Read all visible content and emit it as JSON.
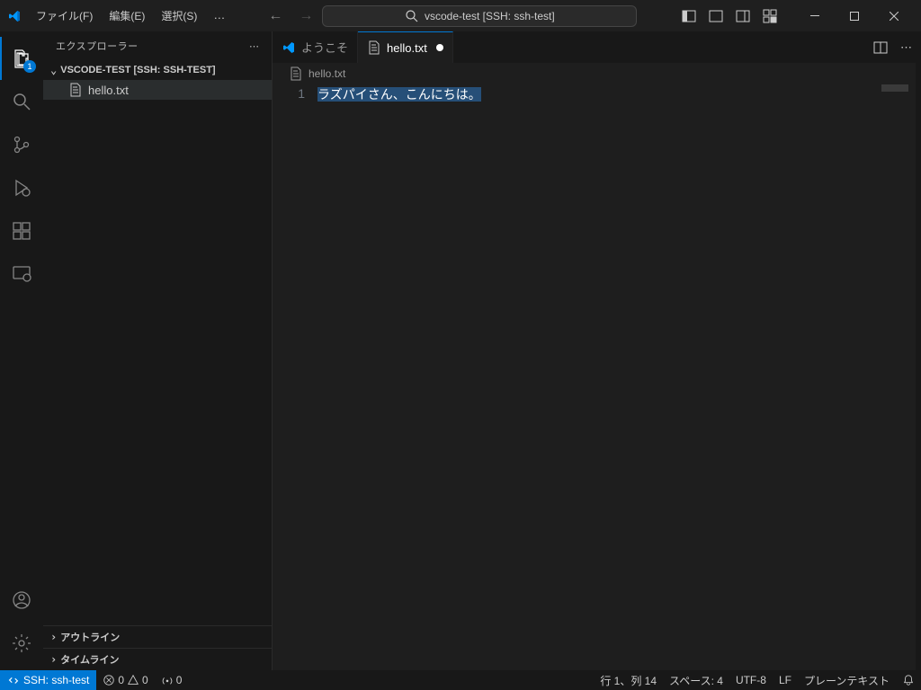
{
  "menu": {
    "file": "ファイル(F)",
    "edit": "編集(E)",
    "select": "選択(S)",
    "more": "…"
  },
  "search_box": "vscode-test [SSH: ssh-test]",
  "sidebar": {
    "title": "エクスプローラー",
    "project_label": "VSCODE-TEST [SSH: SSH-TEST]",
    "files": [
      {
        "name": "hello.txt"
      }
    ],
    "sections": {
      "outline": "アウトライン",
      "timeline": "タイムライン"
    }
  },
  "activity": {
    "explorer_badge": "1"
  },
  "tabs": [
    {
      "label": "ようこそ",
      "active": false,
      "dirty": false
    },
    {
      "label": "hello.txt",
      "active": true,
      "dirty": true
    }
  ],
  "breadcrumb": {
    "file": "hello.txt"
  },
  "editor": {
    "line_number": "1",
    "line_text": "ラズパイさん、こんにちは。"
  },
  "status": {
    "remote": "SSH: ssh-test",
    "errors": "0",
    "warnings": "0",
    "ports": "0",
    "ln_col": "行 1、列 14",
    "spaces": "スペース: 4",
    "encoding": "UTF-8",
    "eol": "LF",
    "lang": "プレーンテキスト"
  }
}
